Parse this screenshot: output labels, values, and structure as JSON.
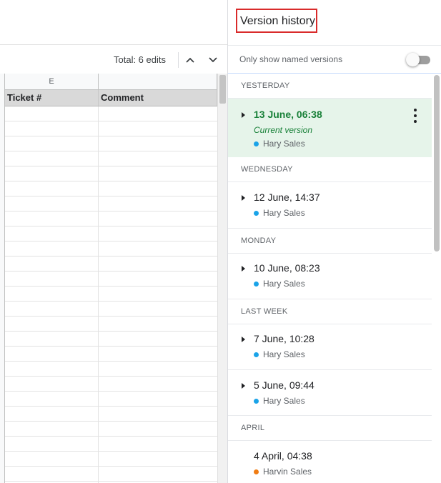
{
  "spreadsheet": {
    "total_edits": "Total: 6 edits",
    "column_letters": [
      "E"
    ],
    "column_headers": [
      "Ticket #",
      "Comment"
    ]
  },
  "panel": {
    "title": "Version history",
    "filter_label": "Only show named versions",
    "filter_enabled": false,
    "sections": [
      {
        "label": "YESTERDAY"
      },
      {
        "label": "WEDNESDAY"
      },
      {
        "label": "MONDAY"
      },
      {
        "label": "LAST WEEK"
      },
      {
        "label": "APRIL"
      }
    ],
    "versions": [
      {
        "date": "13 June, 06:38",
        "current_label": "Current version",
        "user": "Hary Sales",
        "user_color": "#1aa3e8"
      },
      {
        "date": "12 June, 14:37",
        "user": "Hary Sales",
        "user_color": "#1aa3e8"
      },
      {
        "date": "10 June, 08:23",
        "user": "Hary Sales",
        "user_color": "#1aa3e8"
      },
      {
        "date": "7 June, 10:28",
        "user": "Hary Sales",
        "user_color": "#1aa3e8"
      },
      {
        "date": "5 June, 09:44",
        "user": "Hary Sales",
        "user_color": "#1aa3e8"
      },
      {
        "date": "4 April, 04:38",
        "user": "Harvin Sales",
        "user_color": "#f07c13"
      }
    ]
  },
  "icons": {
    "previous": "chevron-up-icon",
    "next": "chevron-down-icon",
    "expand": "caret-right-icon",
    "more": "more-vert-icon"
  },
  "colors": {
    "current_version_bg": "#e6f4ea",
    "current_version_text": "#188038",
    "title_highlight": "#d92b2b"
  }
}
